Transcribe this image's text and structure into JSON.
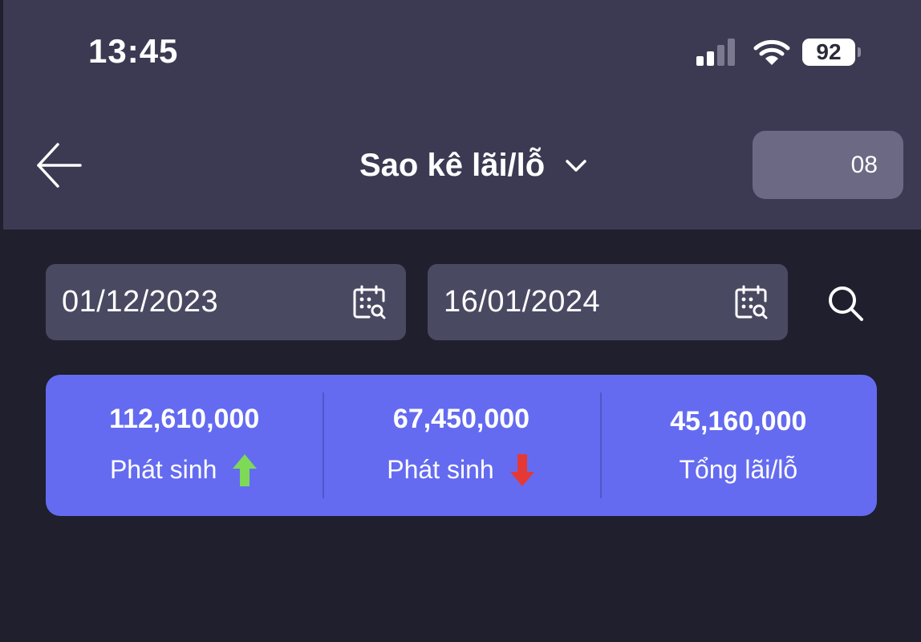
{
  "status_bar": {
    "time": "13:45",
    "battery": "92",
    "signal_icon": "cellular-signal-icon",
    "wifi_icon": "wifi-icon"
  },
  "header": {
    "back_icon": "arrow-left-icon",
    "title": "Sao kê lãi/lỗ",
    "title_icon": "chevron-down-icon",
    "account": "08"
  },
  "filters": {
    "from_date": "01/12/2023",
    "to_date": "16/01/2024",
    "calendar_icon": "calendar-search-icon",
    "search_icon": "search-icon"
  },
  "summary": [
    {
      "amount": "112,610,000",
      "label": "Phát sinh",
      "icon": "arrow-up-icon",
      "icon_color": "#7ed957"
    },
    {
      "amount": "67,450,000",
      "label": "Phát sinh",
      "icon": "arrow-down-icon",
      "icon_color": "#e53935"
    },
    {
      "amount": "45,160,000",
      "label": "Tổng lãi/lỗ"
    }
  ],
  "colors": {
    "background": "#1f1f2e",
    "header": "#3b3a52",
    "field": "#4a4962",
    "account_pill": "#6b6984",
    "summary_card": "#646bf0"
  }
}
